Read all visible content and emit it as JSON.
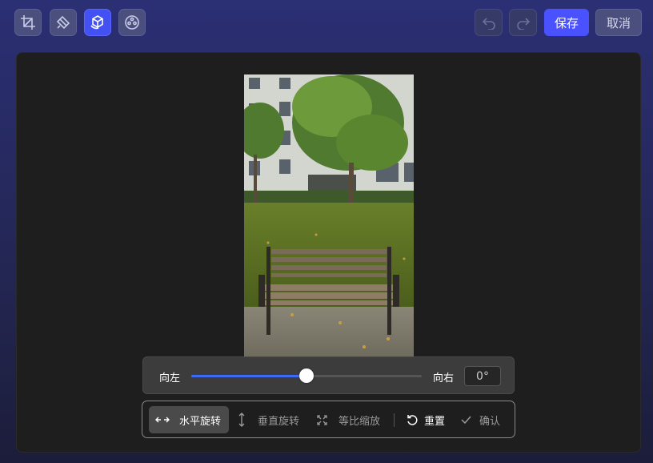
{
  "toolbar": {
    "tools": [
      {
        "name": "crop-icon",
        "active": false
      },
      {
        "name": "brush-icon",
        "active": false
      },
      {
        "name": "transform-icon",
        "active": true
      },
      {
        "name": "filter-icon",
        "active": false
      }
    ],
    "undo_icon": "undo-icon",
    "redo_icon": "redo-icon",
    "save_label": "保存",
    "cancel_label": "取消"
  },
  "rotate": {
    "left_label": "向左",
    "right_label": "向右",
    "degree_value": "0°",
    "slider_fraction": 0.5
  },
  "modes": {
    "horizontal_flip": "水平旋转",
    "vertical_flip": "垂直旋转",
    "proportional_scale": "等比缩放",
    "reset": "重置",
    "confirm": "确认"
  },
  "colors": {
    "accent": "#4a52ff",
    "active_tool": "#4350f2",
    "slider_fill": "#3d6af5"
  }
}
